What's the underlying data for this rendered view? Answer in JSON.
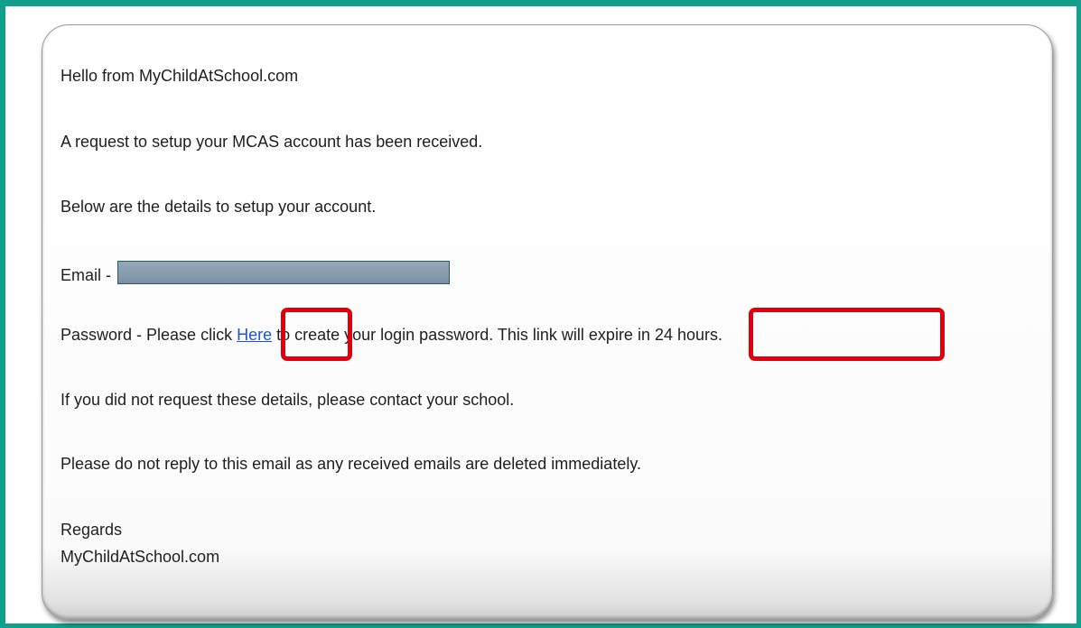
{
  "email": {
    "greeting": "Hello from MyChildAtSchool.com",
    "request_line": "A request to setup your MCAS account has been received.",
    "details_line": "Below are the details to setup your account.",
    "email_label": "Email - ",
    "password_prefix": "Password - Please click ",
    "password_link": "Here",
    "password_middle": " to create your login password. This link will ",
    "password_expiry": "expire in 24 hours",
    "password_end": ".",
    "not_requested_line": "If you did not request these details, please contact your school.",
    "no_reply_line": "Please do not reply to this email as any received emails are deleted immediately.",
    "signoff": "Regards",
    "sender": "MyChildAtSchool.com"
  },
  "colors": {
    "frame_border": "#12a08c",
    "link": "#1a54d6",
    "highlight": "#e0000d",
    "redaction": "#859cad"
  }
}
